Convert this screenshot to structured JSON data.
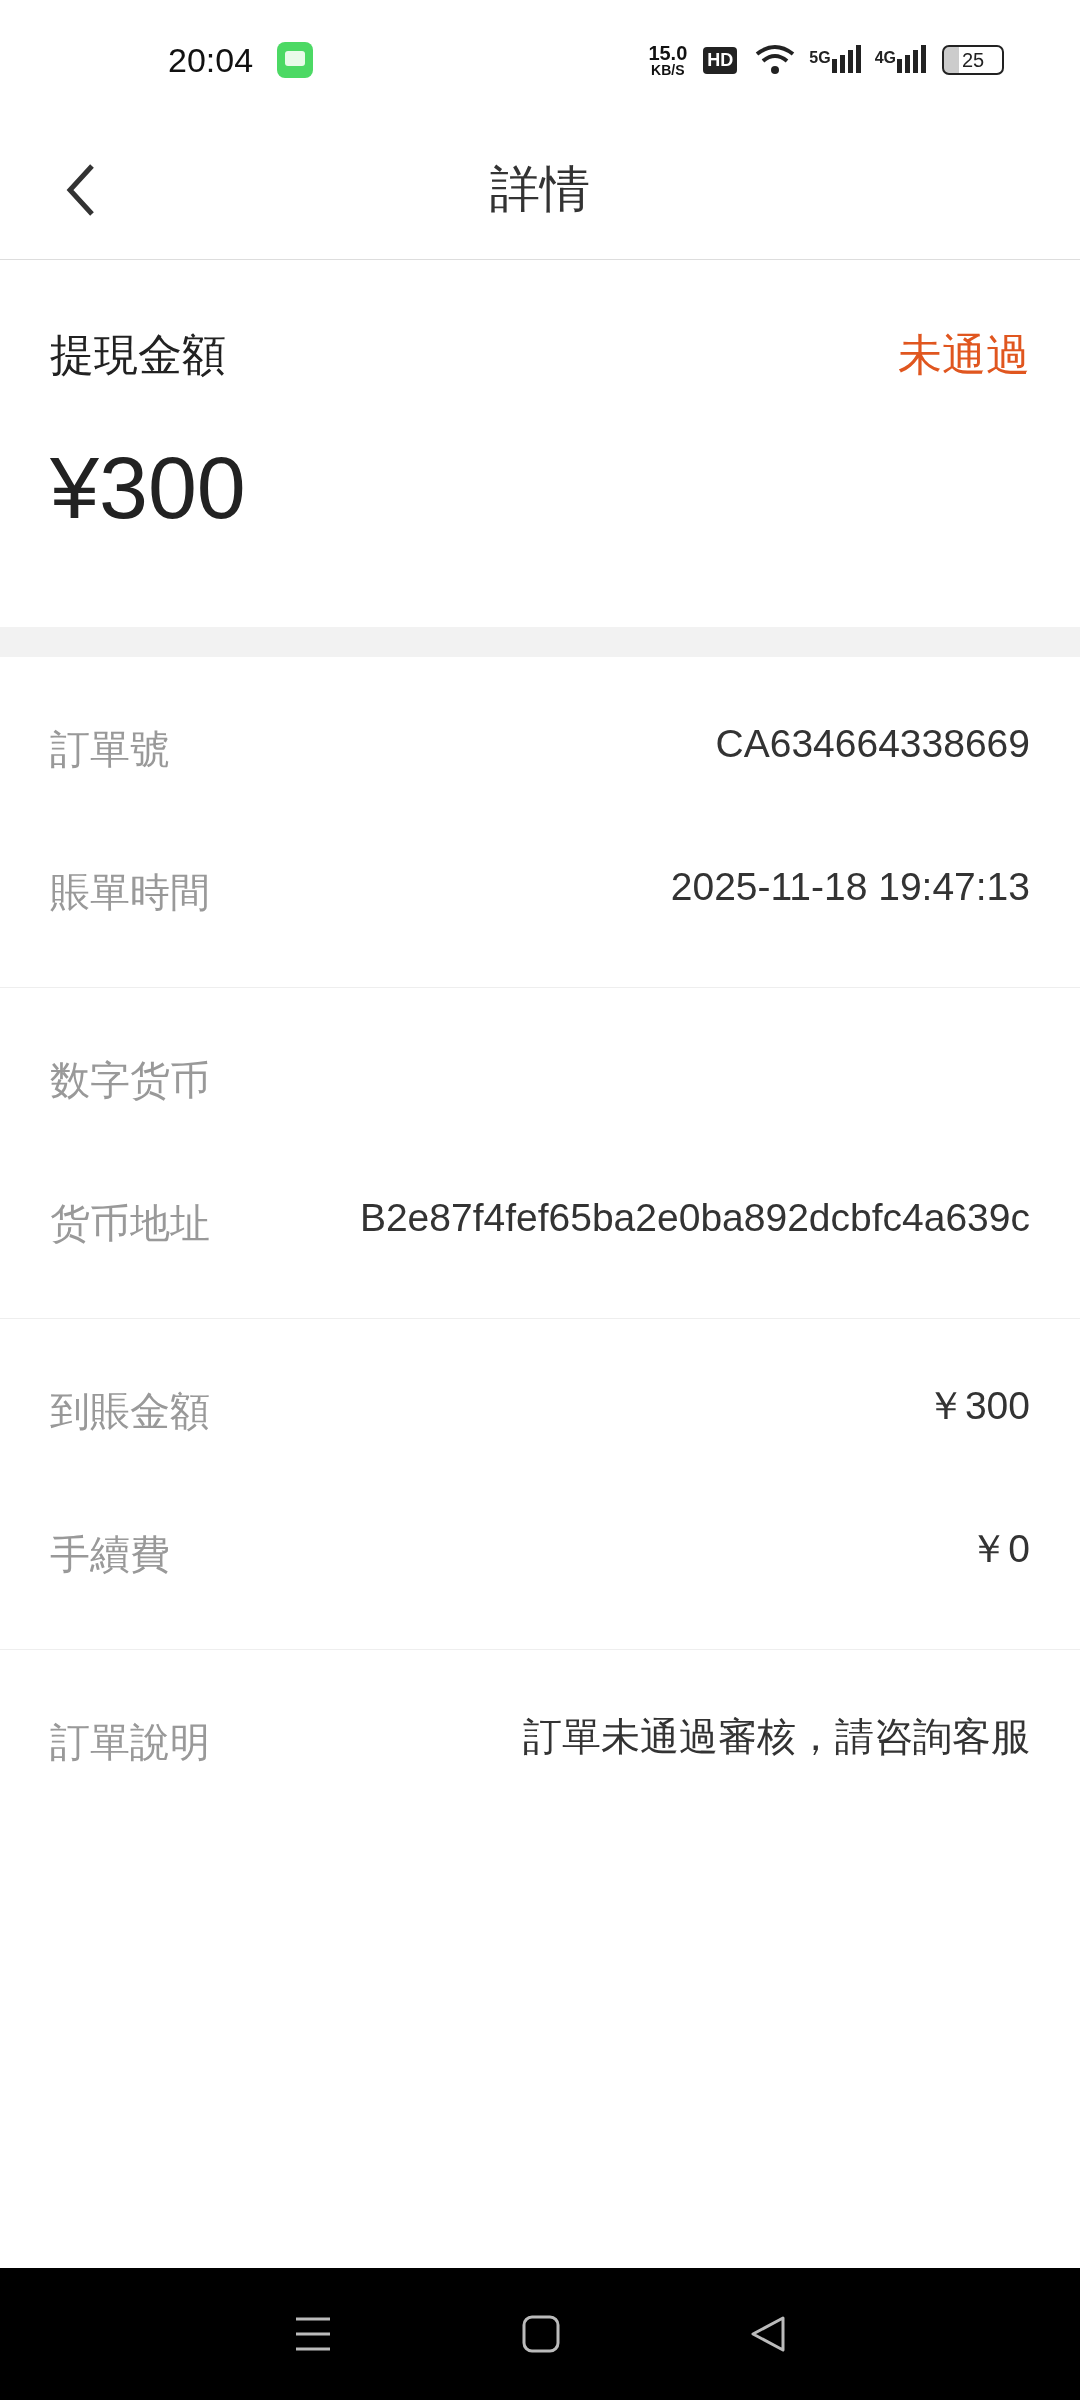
{
  "status_bar": {
    "time": "20:04",
    "speed": "15.0",
    "speed_unit": "KB/S",
    "hd": "HD",
    "network_5g": "5G",
    "network_4g": "4G",
    "battery": "25"
  },
  "header": {
    "title": "詳情"
  },
  "summary": {
    "label": "提現金額",
    "status": "未通過",
    "amount": "¥300"
  },
  "sections": [
    {
      "rows": [
        {
          "label": "訂單號",
          "value": "CA634664338669"
        },
        {
          "label": "賬單時間",
          "value": "2025-11-18 19:47:13"
        }
      ]
    },
    {
      "rows": [
        {
          "label": "数字货币"
        },
        {
          "label": "货币地址",
          "value": "B2e87f4fef65ba2e0ba892dcbfc4a639c"
        }
      ]
    },
    {
      "rows": [
        {
          "label": "到賬金額",
          "value": "￥300"
        },
        {
          "label": "手續費",
          "value": "￥0"
        }
      ]
    },
    {
      "rows": [
        {
          "label": "訂單說明",
          "value": "訂單未通過審核，請咨詢客服"
        }
      ]
    }
  ]
}
